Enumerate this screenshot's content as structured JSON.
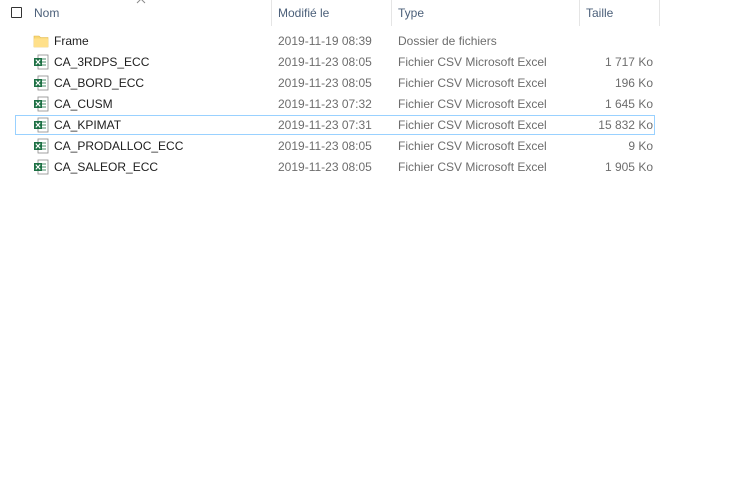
{
  "columns": {
    "name": "Nom",
    "date": "Modifié le",
    "type": "Type",
    "size": "Taille"
  },
  "files": [
    {
      "name": "Frame",
      "date": "2019-11-19 08:39",
      "type": "Dossier de fichiers",
      "size": "",
      "icon": "folder-icon"
    },
    {
      "name": "CA_3RDPS_ECC",
      "date": "2019-11-23 08:05",
      "type": "Fichier CSV Microsoft Excel",
      "size": "1 717 Ko",
      "icon": "excel-csv-icon"
    },
    {
      "name": "CA_BORD_ECC",
      "date": "2019-11-23 08:05",
      "type": "Fichier CSV Microsoft Excel",
      "size": "196 Ko",
      "icon": "excel-csv-icon"
    },
    {
      "name": "CA_CUSM",
      "date": "2019-11-23 07:32",
      "type": "Fichier CSV Microsoft Excel",
      "size": "1 645 Ko",
      "icon": "excel-csv-icon"
    },
    {
      "name": "CA_KPIMAT",
      "date": "2019-11-23 07:31",
      "type": "Fichier CSV Microsoft Excel",
      "size": "15 832 Ko",
      "icon": "excel-csv-icon",
      "focused": true
    },
    {
      "name": "CA_PRODALLOC_ECC",
      "date": "2019-11-23 08:05",
      "type": "Fichier CSV Microsoft Excel",
      "size": "9 Ko",
      "icon": "excel-csv-icon"
    },
    {
      "name": "CA_SALEOR_ECC",
      "date": "2019-11-23 08:05",
      "type": "Fichier CSV Microsoft Excel",
      "size": "1 905 Ko",
      "icon": "excel-csv-icon"
    }
  ],
  "colors": {
    "header_text": "#4c607a",
    "focus_border": "#99d1ff",
    "excel_green": "#1d7044",
    "folder_yellow": "#f8d775"
  }
}
